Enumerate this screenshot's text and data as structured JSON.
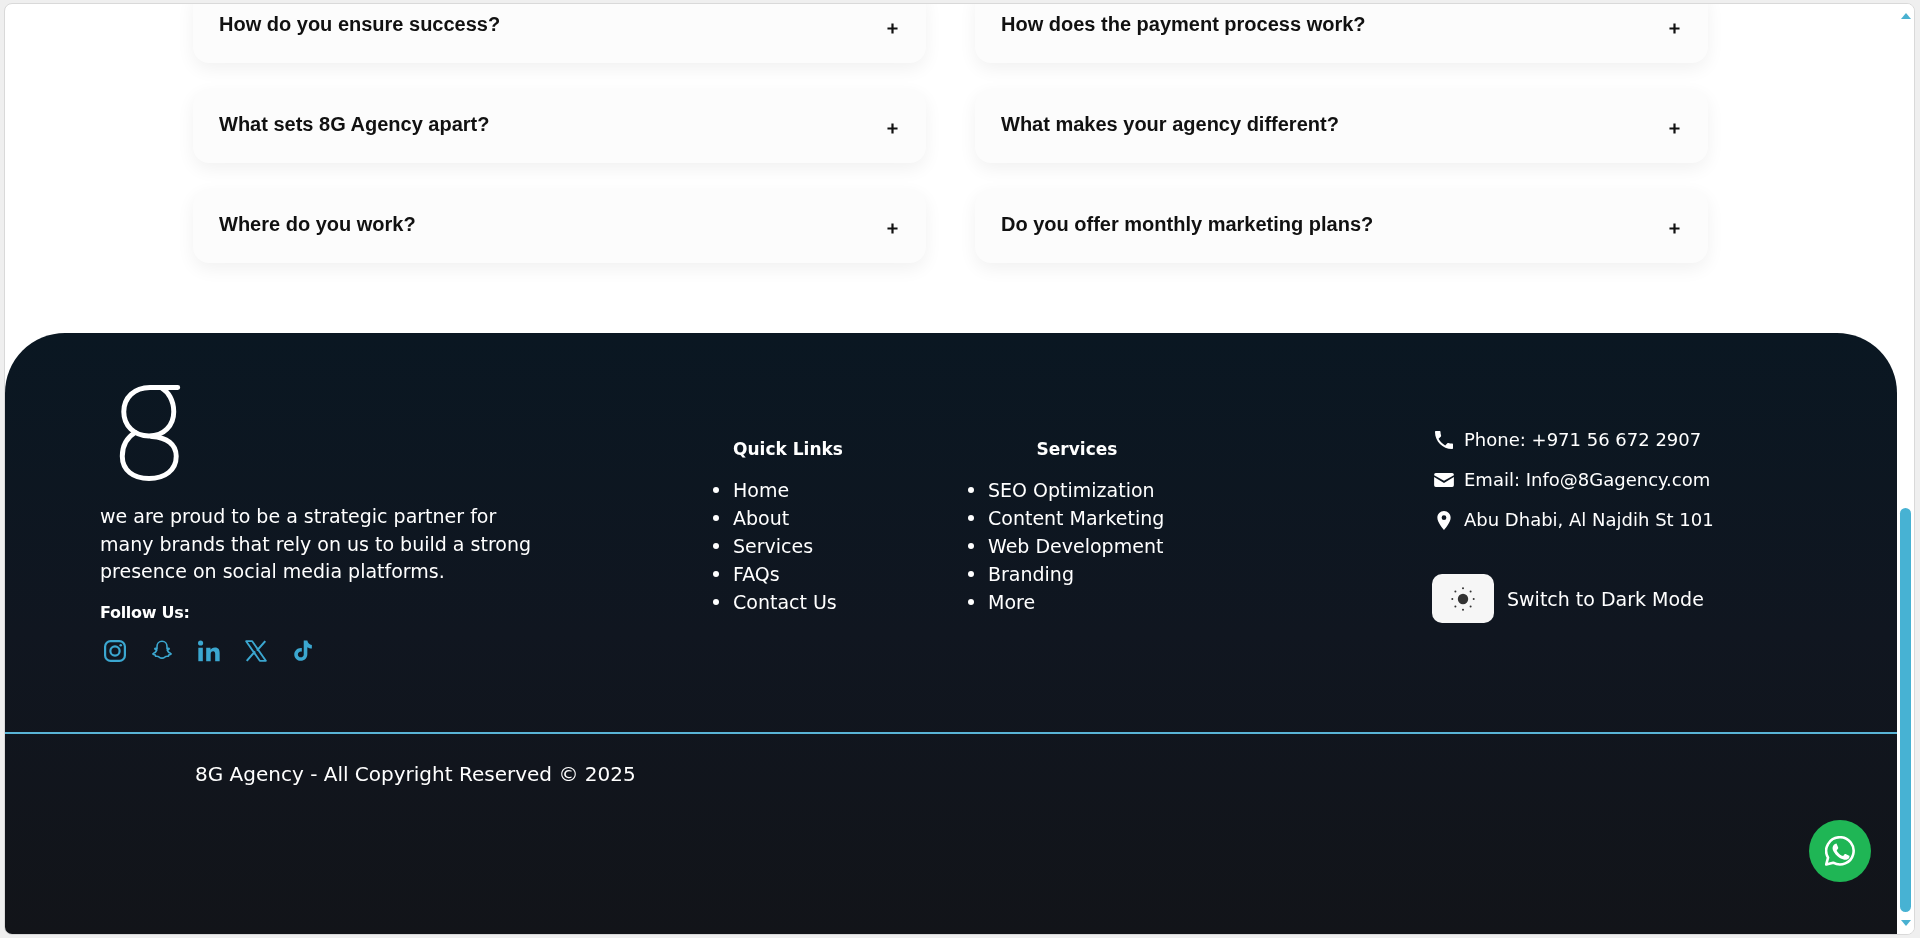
{
  "faq": {
    "items": [
      {
        "question": "How do you ensure success?",
        "expanded": false
      },
      {
        "question": "How does the payment process work?",
        "expanded": false
      },
      {
        "question": "What sets 8G Agency apart?",
        "expanded": false
      },
      {
        "question": "What makes your agency different?",
        "expanded": false
      },
      {
        "question": "Where do you work?",
        "expanded": false
      },
      {
        "question": "Do you offer monthly marketing plans?",
        "expanded": false
      }
    ]
  },
  "footer": {
    "brand": {
      "description": "we are proud to be a strategic partner for many brands that rely on us to build a strong presence on social media platforms.",
      "follow_label": "Follow Us:",
      "social": [
        {
          "kind": "instagram"
        },
        {
          "kind": "snapchat"
        },
        {
          "kind": "linkedin"
        },
        {
          "kind": "x"
        },
        {
          "kind": "tiktok"
        }
      ]
    },
    "quick_links": {
      "title": "Quick Links",
      "items": [
        "Home",
        "About",
        "Services",
        "FAQs",
        "Contact Us"
      ]
    },
    "services": {
      "title": "Services",
      "items": [
        "SEO Optimization",
        "Content Marketing",
        "Web Development",
        "Branding",
        "More"
      ]
    },
    "contact": [
      {
        "kind": "phone",
        "text": "Phone: +971 56 672 2907"
      },
      {
        "kind": "email",
        "text": "Email: Info@8Gagency.com"
      },
      {
        "kind": "location",
        "text": "Abu Dhabi, Al Najdih St 101"
      }
    ],
    "theme_toggle": {
      "label": "Switch to Dark Mode"
    },
    "copyright": "8G Agency - All Copyright Reserved © 2025"
  }
}
